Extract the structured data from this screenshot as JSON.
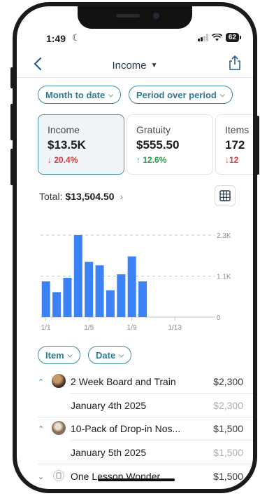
{
  "status_bar": {
    "time": "1:49",
    "battery": "62"
  },
  "nav": {
    "title": "Income"
  },
  "filters": {
    "period": "Month to date",
    "comparison": "Period over period"
  },
  "cards": [
    {
      "label": "Income",
      "value": "$13.5K",
      "change": "20.4%",
      "direction": "down"
    },
    {
      "label": "Gratuity",
      "value": "$555.50",
      "change": "12.6%",
      "direction": "up"
    },
    {
      "label": "Items",
      "value": "172",
      "change": "12",
      "direction": "down"
    }
  ],
  "total": {
    "label": "Total:",
    "value": "$13,504.50"
  },
  "chart_data": {
    "type": "bar",
    "x": [
      "1/1",
      "1/2",
      "1/3",
      "1/4",
      "1/5",
      "1/6",
      "1/7",
      "1/8",
      "1/9",
      "1/10",
      "1/11",
      "1/12",
      "1/13",
      "1/14",
      "1/15",
      "1/16"
    ],
    "values": [
      1000,
      700,
      1100,
      2300,
      1550,
      1450,
      750,
      1200,
      1700,
      1000,
      0,
      0,
      0,
      0,
      0,
      0
    ],
    "x_tick_labels": [
      "1/1",
      "1/5",
      "1/9",
      "1/13"
    ],
    "y_tick_labels": [
      "0",
      "1.1K",
      "2.3K"
    ],
    "ylim": [
      0,
      2300
    ],
    "colors": {
      "bar": "#3b82f6",
      "grid": "#c7c7cc",
      "axis": "#8e8e93"
    }
  },
  "group_filters": {
    "item": "Item",
    "date": "Date"
  },
  "rows": [
    {
      "type": "group",
      "expanded": true,
      "name": "2 Week Board and Train",
      "amount": "$2,300"
    },
    {
      "type": "sub",
      "name": "January 4th 2025",
      "amount": "$2,300"
    },
    {
      "type": "group",
      "expanded": true,
      "name": "10-Pack of Drop-in Nos...",
      "amount": "$1,500"
    },
    {
      "type": "sub",
      "name": "January 5th 2025",
      "amount": "$1,500"
    },
    {
      "type": "group",
      "expanded": false,
      "name": "One Lesson Wonder",
      "amount": "$1,500"
    }
  ]
}
